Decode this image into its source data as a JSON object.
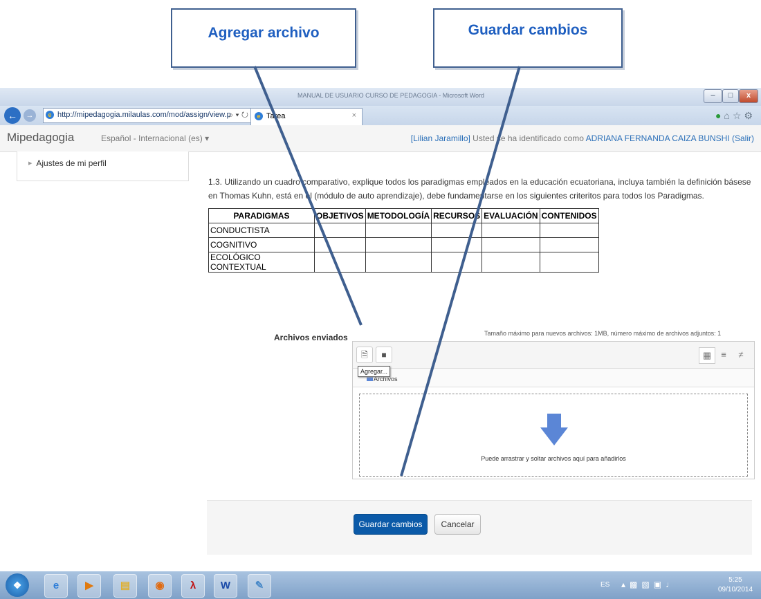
{
  "callouts": {
    "agregar": "Agregar archivo",
    "guardar": "Guardar cambios"
  },
  "browser": {
    "window_title": "MANUAL DE USUARIO CURSO DE PEDAGOGIA - Microsoft Word",
    "url": "http://mipedagogia.milaulas.com/mod/assign/view.p",
    "address_controls": "⌕ ▾ ↻",
    "tab_title": "Tarea",
    "tab_close": "×",
    "window_buttons": [
      "–",
      "□",
      "x"
    ]
  },
  "site": {
    "brand": "Mipedagogia",
    "language": "Español - Internacional (es) ▾",
    "login_user": "[Lilian Jaramillo]",
    "login_text": " Usted se ha identificado como ",
    "login_name": "ADRIANA FERNANDA CAIZA BUNSHI",
    "logout": "(Salir)"
  },
  "sidebar": {
    "item": "Ajustes de mi perfil"
  },
  "question": {
    "text": "1.3. Utilizando un cuadro comparativo, explique todos los paradigmas empleados en la educación ecuatoriana, incluya también la definición básese en Thomas Kuhn, está en el (módulo de auto aprendizaje), debe fundamentarse en los siguientes criteritos para todos los Paradigmas."
  },
  "table": {
    "headers": [
      "PARADIGMAS",
      "OBJETIVOS",
      "METODOLOGÍA",
      "RECURSOS",
      "EVALUACIÓN",
      "CONTENIDOS"
    ],
    "rows": [
      "CONDUCTISTA",
      "COGNITIVO",
      "ECOLÓGICO CONTEXTUAL"
    ]
  },
  "files": {
    "label": "Archivos enviados",
    "max_info": "Tamaño máximo para nuevos archivos: 1MB, número máximo de archivos adjuntos: 1",
    "tooltip": "Agregar...",
    "folder_label": "Archivos",
    "drop_text": "Puede arrastrar y soltar archivos aquí para añadirlos"
  },
  "actions": {
    "save": "Guardar cambios",
    "cancel": "Cancelar"
  },
  "taskbar": {
    "language": "ES",
    "time": "5:25",
    "date": "09/10/2014"
  },
  "colors": {
    "accent": "#0b5aa8",
    "callout_text": "#1f5fc0",
    "callout_border": "#3f5f8f",
    "drop_arrow": "#5b86d6"
  }
}
